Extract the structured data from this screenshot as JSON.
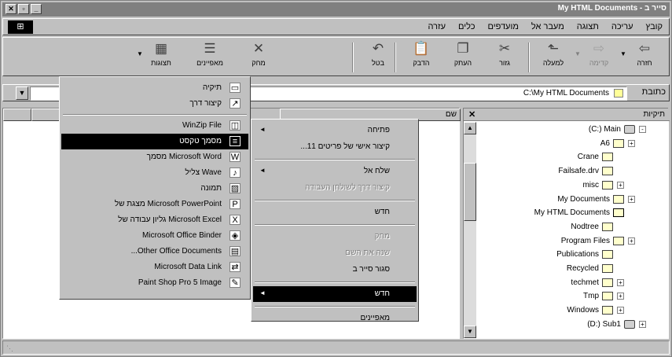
{
  "window": {
    "title": "My HTML Documents - סייר ב"
  },
  "titlebar": {
    "controls": [
      "✕",
      "▫",
      "_"
    ]
  },
  "menubar": {
    "items": [
      "קובץ",
      "עריכה",
      "תצוגה",
      "מעבר אל",
      "מועדפים",
      "כלים",
      "עזרה"
    ]
  },
  "toolbar": {
    "buttons": [
      {
        "label": "חזרה",
        "icon": "back-arrow-icon",
        "glyph": "⇦",
        "enabled": true
      },
      {
        "label": "קדימה",
        "icon": "forward-arrow-icon",
        "glyph": "⇨",
        "enabled": false
      },
      {
        "label": "למעלה",
        "icon": "up-folder-icon",
        "glyph": "⬑",
        "enabled": true
      },
      {
        "label": "גזור",
        "icon": "scissors-icon",
        "glyph": "✂",
        "enabled": true
      },
      {
        "label": "העתק",
        "icon": "copy-icon",
        "glyph": "❐",
        "enabled": true
      },
      {
        "label": "הדבק",
        "icon": "paste-icon",
        "glyph": "📋",
        "enabled": true
      },
      {
        "label": "בטל",
        "icon": "undo-icon",
        "glyph": "↶",
        "enabled": true
      },
      {
        "label": "מחק",
        "icon": "delete-x-icon",
        "glyph": "✕",
        "enabled": true
      },
      {
        "label": "מאפיינים",
        "icon": "properties-icon",
        "glyph": "☰",
        "enabled": true
      },
      {
        "label": "תצוגות",
        "icon": "views-icon",
        "glyph": "▦",
        "enabled": true
      }
    ]
  },
  "address": {
    "label": "כתובת",
    "value": "C:\\My HTML Documents"
  },
  "tree": {
    "header": "תיקיות",
    "close": "✕",
    "nodes": [
      {
        "label": "(C:) Main",
        "kind": "drive",
        "expand": "-"
      },
      {
        "label": "A6",
        "kind": "folder",
        "expand": "+"
      },
      {
        "label": "Crane",
        "kind": "folder",
        "expand": ""
      },
      {
        "label": "Failsafe.drv",
        "kind": "folder",
        "expand": ""
      },
      {
        "label": "misc",
        "kind": "folder",
        "expand": "+"
      },
      {
        "label": "My Documents",
        "kind": "folder",
        "expand": "+"
      },
      {
        "label": "My HTML Documents",
        "kind": "open",
        "expand": ""
      },
      {
        "label": "Nodtree",
        "kind": "folder",
        "expand": ""
      },
      {
        "label": "Program Files",
        "kind": "folder",
        "expand": "+"
      },
      {
        "label": "Publications",
        "kind": "folder",
        "expand": ""
      },
      {
        "label": "Recycled",
        "kind": "folder",
        "expand": ""
      },
      {
        "label": "techmet",
        "kind": "folder",
        "expand": "+"
      },
      {
        "label": "Tmp",
        "kind": "folder",
        "expand": "+"
      },
      {
        "label": "Windows",
        "kind": "folder",
        "expand": "+"
      },
      {
        "label": "(D:) Sub1",
        "kind": "drive",
        "expand": "+"
      }
    ]
  },
  "listpane": {
    "columns": [
      "שם",
      "",
      ""
    ]
  },
  "filemenu": {
    "items": [
      {
        "label": "פתיחה",
        "state": "normal",
        "arrow": "◄"
      },
      {
        "label": "קיצור אישי של פריטים 11...",
        "state": "normal",
        "arrow": ""
      },
      {
        "sep": true
      },
      {
        "label": "שלח אל",
        "state": "normal",
        "arrow": "◄"
      },
      {
        "label": "קיצור דרך לשולחן העבודה",
        "state": "disabled",
        "arrow": ""
      },
      {
        "sep": true
      },
      {
        "label": "חדש",
        "state": "normal",
        "arrow": ""
      },
      {
        "sep": true
      },
      {
        "label": "מחק",
        "state": "disabled",
        "arrow": ""
      },
      {
        "label": "שנה את השם",
        "state": "disabled",
        "arrow": ""
      },
      {
        "label": "סגור סייר ב",
        "state": "normal",
        "arrow": ""
      },
      {
        "sep": true
      },
      {
        "label": "חדש",
        "state": "selected",
        "arrow": "◄"
      },
      {
        "sep": true
      },
      {
        "label": "מאפיינים",
        "state": "normal",
        "arrow": ""
      }
    ]
  },
  "newsubmenu": {
    "items": [
      {
        "label": "תיקיה",
        "icon": "folder-icon",
        "glyph": "▭",
        "state": "normal"
      },
      {
        "label": "קיצור דרך",
        "icon": "shortcut-arrow-icon",
        "glyph": "↗",
        "state": "normal"
      },
      {
        "sep": true
      },
      {
        "label": "WinZip File",
        "icon": "winzip-icon",
        "glyph": "◫",
        "state": "normal"
      },
      {
        "label": "מסמך טקסט",
        "icon": "text-document-icon",
        "glyph": "≡",
        "state": "selected"
      },
      {
        "label": "Microsoft Word מסמך",
        "icon": "word-document-icon",
        "glyph": "W",
        "state": "normal"
      },
      {
        "label": "Wave צליל",
        "icon": "wave-sound-icon",
        "glyph": "♪",
        "state": "normal"
      },
      {
        "label": "תמונה",
        "icon": "bitmap-image-icon",
        "glyph": "▨",
        "state": "normal"
      },
      {
        "label": "Microsoft PowerPoint מצגת של",
        "icon": "powerpoint-icon",
        "glyph": "P",
        "state": "normal"
      },
      {
        "label": "Microsoft Excel גליון עבודה של",
        "icon": "excel-icon",
        "glyph": "X",
        "state": "normal"
      },
      {
        "label": "Microsoft Office Binder",
        "icon": "office-binder-icon",
        "glyph": "◈",
        "state": "normal"
      },
      {
        "label": "Other Office Documents...",
        "icon": "office-documents-icon",
        "glyph": "▤",
        "state": "normal"
      },
      {
        "label": "Microsoft Data Link",
        "icon": "data-link-icon",
        "glyph": "⇄",
        "state": "normal"
      },
      {
        "label": "Paint Shop Pro 5 Image",
        "icon": "paint-shop-pro-icon",
        "glyph": "✎",
        "state": "normal"
      }
    ]
  }
}
